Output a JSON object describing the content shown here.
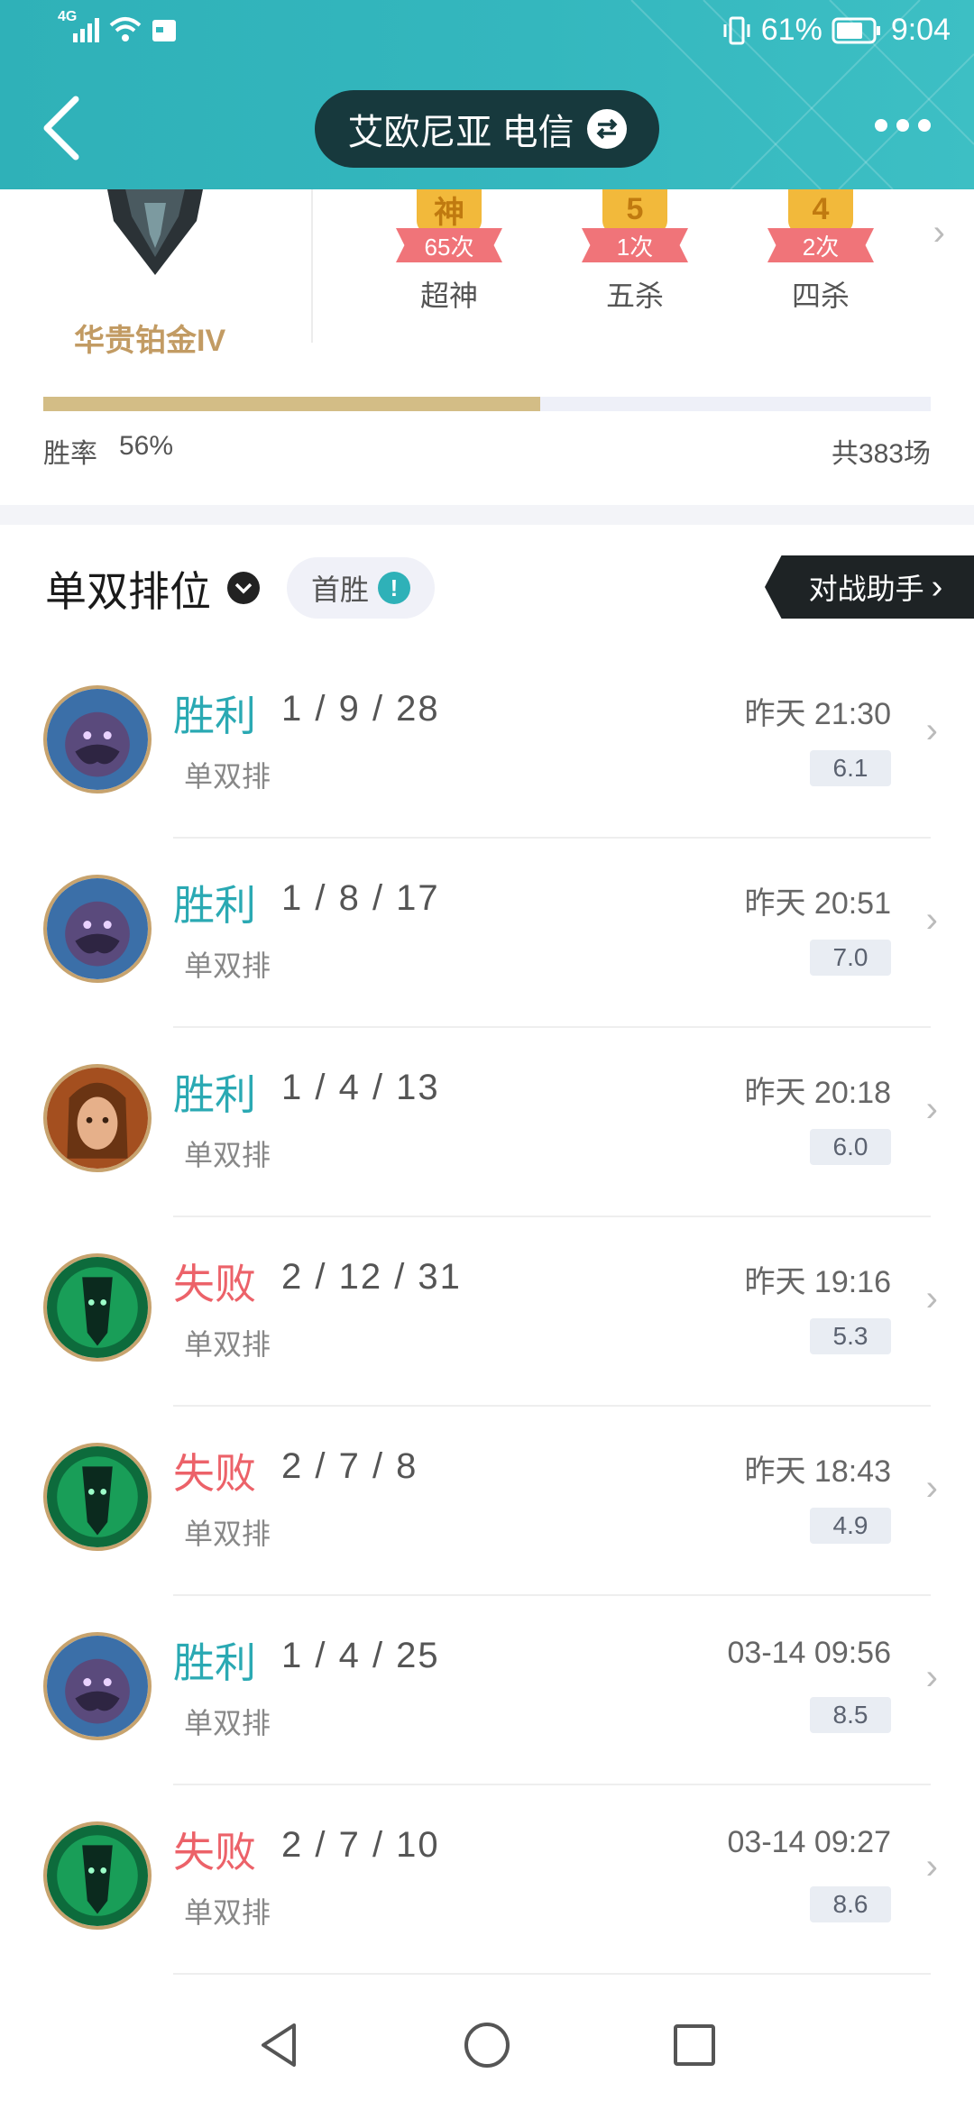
{
  "status_bar": {
    "network": "4G",
    "battery": "61%",
    "time": "9:04"
  },
  "header": {
    "server": "艾欧尼亚 电信"
  },
  "summary": {
    "rank": "华贵铂金IV",
    "honors": [
      {
        "glyph": "神",
        "count": "65次",
        "label": "超神"
      },
      {
        "glyph": "5",
        "count": "1次",
        "label": "五杀"
      },
      {
        "glyph": "4",
        "count": "2次",
        "label": "四杀"
      }
    ],
    "win_rate_label": "胜率",
    "win_rate": "56%",
    "win_rate_fraction": 0.56,
    "total_games": "共383场"
  },
  "mode_filter": {
    "title": "单双排位",
    "first_win": "首胜",
    "assistant": "对战助手"
  },
  "matches": [
    {
      "result": "胜利",
      "kda": "1 / 9 / 28",
      "mode": "单双排",
      "time": "昨天 21:30",
      "score": "6.1",
      "champion": "purple-mustache"
    },
    {
      "result": "胜利",
      "kda": "1 / 8 / 17",
      "mode": "单双排",
      "time": "昨天 20:51",
      "score": "7.0",
      "champion": "purple-mustache"
    },
    {
      "result": "胜利",
      "kda": "1 / 4 / 13",
      "mode": "单双排",
      "time": "昨天 20:18",
      "score": "6.0",
      "champion": "brown-hair-woman"
    },
    {
      "result": "失败",
      "kda": "2 / 12 / 31",
      "mode": "单双排",
      "time": "昨天 19:16",
      "score": "5.3",
      "champion": "green-spectre"
    },
    {
      "result": "失败",
      "kda": "2 / 7 / 8",
      "mode": "单双排",
      "time": "昨天 18:43",
      "score": "4.9",
      "champion": "green-spectre"
    },
    {
      "result": "胜利",
      "kda": "1 / 4 / 25",
      "mode": "单双排",
      "time": "03-14 09:56",
      "score": "8.5",
      "champion": "purple-mustache"
    },
    {
      "result": "失败",
      "kda": "2 / 7 / 10",
      "mode": "单双排",
      "time": "03-14 09:27",
      "score": "8.6",
      "champion": "green-spectre"
    }
  ],
  "colors": {
    "header": "#2fb1b8",
    "win": "#2aa9b3",
    "loss": "#ec6269",
    "rank": "#c29b63",
    "winbar": "#d3bd86"
  }
}
